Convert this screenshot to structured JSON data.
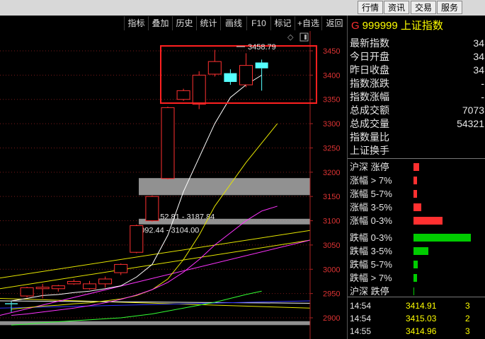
{
  "topbar": {
    "buttons": [
      "行情",
      "资讯",
      "交易",
      "服务"
    ]
  },
  "toolbar": {
    "buttons": [
      "指标",
      "叠加",
      "历史",
      "统计",
      "画线",
      "F10",
      "标记",
      "+自选",
      "返回"
    ]
  },
  "header": {
    "prefix": "G",
    "code": "999999",
    "name": "上证指数"
  },
  "info": [
    {
      "label": "最新指数",
      "value": "34"
    },
    {
      "label": "今日开盘",
      "value": "34"
    },
    {
      "label": "昨日收盘",
      "value": "34"
    },
    {
      "label": "指数涨跌",
      "value": "-"
    },
    {
      "label": "指数涨幅",
      "value": "-"
    },
    {
      "label": "总成交额",
      "value": "7073"
    },
    {
      "label": "总成交量",
      "value": "54321"
    },
    {
      "label": "指数量比",
      "value": ""
    },
    {
      "label": "上证换手",
      "value": ""
    }
  ],
  "breadth": [
    {
      "label": "沪深 涨停",
      "value": 0.09,
      "color": "#ff3030"
    },
    {
      "label": "涨幅 > 7%",
      "value": 0.06,
      "color": "#ff3030"
    },
    {
      "label": "涨幅 5-7%",
      "value": 0.06,
      "color": "#ff3030"
    },
    {
      "label": "涨幅 3-5%",
      "value": 0.12,
      "color": "#ff3030"
    },
    {
      "label": "涨幅 0-3%",
      "value": 0.45,
      "color": "#ff3030"
    },
    {
      "label": "跌幅 0-3%",
      "value": 0.9,
      "color": "#00cc00"
    },
    {
      "label": "跌幅 3-5%",
      "value": 0.23,
      "color": "#00cc00"
    },
    {
      "label": "跌幅 5-7%",
      "value": 0.07,
      "color": "#00cc00"
    },
    {
      "label": "跌幅 > 7%",
      "value": 0.06,
      "color": "#00cc00"
    },
    {
      "label": "沪深 跌停",
      "value": 0.01,
      "color": "#00cc00"
    }
  ],
  "ticks": [
    {
      "time": "14:54",
      "price": "3414.91",
      "vol": "3"
    },
    {
      "time": "14:54",
      "price": "3415.03",
      "vol": "2"
    },
    {
      "time": "14:55",
      "price": "3414.96",
      "vol": "3"
    }
  ],
  "chart_data": {
    "type": "candlestick",
    "ylim": [
      2885,
      3465
    ],
    "yticks": [
      2900,
      2950,
      3000,
      3050,
      3100,
      3150,
      3200,
      3250,
      3300,
      3350,
      3400,
      3450
    ],
    "candles": [
      {
        "o": 2930,
        "c": 2928,
        "h": 2934,
        "l": 2912
      },
      {
        "o": 2945,
        "c": 2962,
        "h": 2964,
        "l": 2942
      },
      {
        "o": 2960,
        "c": 2963,
        "h": 2970,
        "l": 2940
      },
      {
        "o": 2960,
        "c": 2966,
        "h": 2968,
        "l": 2954
      },
      {
        "o": 2970,
        "c": 2975,
        "h": 2979,
        "l": 2968
      },
      {
        "o": 2960,
        "c": 2970,
        "h": 2976,
        "l": 2958
      },
      {
        "o": 2970,
        "c": 2980,
        "h": 2985,
        "l": 2962
      },
      {
        "o": 2993,
        "c": 3010,
        "h": 3012,
        "l": 2988
      },
      {
        "o": 3035,
        "c": 3090,
        "h": 3092,
        "l": 3033
      },
      {
        "o": 3100,
        "c": 3150,
        "h": 3152,
        "l": 3098
      },
      {
        "o": 3187,
        "c": 3333,
        "h": 3335,
        "l": 3185
      },
      {
        "o": 3350,
        "c": 3368,
        "h": 3372,
        "l": 3347
      },
      {
        "o": 3340,
        "c": 3400,
        "h": 3408,
        "l": 3330
      },
      {
        "o": 3402,
        "c": 3428,
        "h": 3452,
        "l": 3397
      },
      {
        "o": 3404,
        "c": 3386,
        "h": 3412,
        "l": 3380
      },
      {
        "o": 3380,
        "c": 3420,
        "h": 3445,
        "l": 3375
      },
      {
        "o": 3426,
        "c": 3414,
        "h": 3432,
        "l": 3368
      }
    ],
    "ma": [
      {
        "color": "#ffffff",
        "values": [
          2935,
          2940,
          2946,
          2948,
          2952,
          2955,
          2960,
          2966,
          2984,
          3010,
          3070,
          3160,
          3230,
          3300,
          3354,
          3380,
          3400
        ]
      },
      {
        "color": "#e6e600",
        "values": [
          2918,
          2921,
          2924,
          2926,
          2929,
          2931,
          2935,
          2939,
          2946,
          2958,
          2980,
          3020,
          3070,
          3130,
          3175,
          3220,
          3260,
          3300
        ]
      },
      {
        "color": "#ff33ff",
        "values": [
          2905,
          2908,
          2912,
          2916,
          2920,
          2925,
          2931,
          2938,
          2947,
          2958,
          2973,
          2994,
          3020,
          3050,
          3075,
          3100,
          3120,
          3130
        ]
      },
      {
        "color": "#33ff33",
        "values": [
          2885,
          2887,
          2890,
          2892,
          2894,
          2896,
          2898,
          2900,
          2904,
          2908,
          2914,
          2920,
          2926,
          2932,
          2940,
          2948,
          2955
        ]
      }
    ],
    "long_lines": [
      {
        "color": "#e6e600",
        "from": 2982,
        "to": 3080
      },
      {
        "color": "#e6e600",
        "from": 2960,
        "to": 3060
      },
      {
        "color": "#e6e600",
        "from": 2940,
        "to": 2920
      },
      {
        "color": "#ffffff",
        "from": 2935,
        "to": 2930
      },
      {
        "color": "#3030ff",
        "from": 2920,
        "to": 2935
      },
      {
        "color": "#ff33ff",
        "from": 2905,
        "to": 3060
      }
    ],
    "gap_bands": [
      {
        "from": 3152.81,
        "to": 3187.84,
        "label": "3152.81 - 3187.84"
      },
      {
        "from": 3092.44,
        "to": 3104.0,
        "label": "3092.44 - 3104.00"
      }
    ],
    "bottom_band": {
      "from": 2885,
      "to": 2893
    },
    "peak_label": "3458.79",
    "peak_value": 3458.79
  }
}
